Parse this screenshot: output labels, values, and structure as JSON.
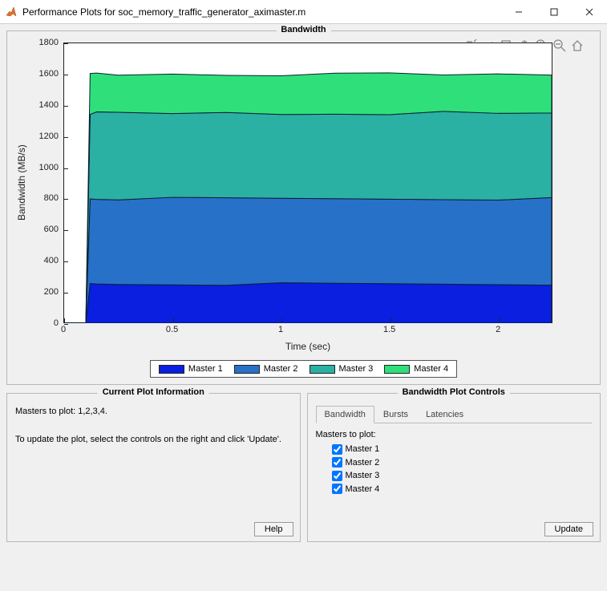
{
  "window": {
    "title": "Performance Plots for soc_memory_traffic_generator_aximaster.m"
  },
  "chart_panel": {
    "title": "Bandwidth"
  },
  "chart": {
    "ylabel": "Bandwidth (MB/s)",
    "xlabel": "Time (sec)",
    "yticks": [
      "0",
      "200",
      "400",
      "600",
      "800",
      "1000",
      "1200",
      "1400",
      "1600",
      "1800"
    ],
    "xticks": [
      "0",
      "0.5",
      "1",
      "1.5",
      "2"
    ],
    "legend": [
      "Master 1",
      "Master 2",
      "Master 3",
      "Master 4"
    ],
    "colors": [
      "#0a1fe0",
      "#2771c8",
      "#2bb0a4",
      "#2fe07a"
    ]
  },
  "chart_data": {
    "type": "area",
    "title": "Bandwidth",
    "xlabel": "Time (sec)",
    "ylabel": "Bandwidth (MB/s)",
    "xlim": [
      0,
      2.25
    ],
    "ylim": [
      0,
      1800
    ],
    "stacked": true,
    "x": [
      0,
      0.1,
      0.12,
      0.15,
      0.25,
      0.5,
      0.75,
      1.0,
      1.25,
      1.5,
      1.75,
      2.0,
      2.25
    ],
    "series": [
      {
        "name": "Master 1",
        "color": "#0a1fe0",
        "values": [
          0,
          0,
          250,
          250,
          250,
          250,
          250,
          250,
          250,
          250,
          250,
          250,
          250
        ]
      },
      {
        "name": "Master 2",
        "color": "#2771c8",
        "values": [
          0,
          0,
          550,
          550,
          550,
          550,
          550,
          550,
          550,
          550,
          550,
          550,
          550
        ]
      },
      {
        "name": "Master 3",
        "color": "#2bb0a4",
        "values": [
          0,
          0,
          550,
          550,
          550,
          545,
          555,
          545,
          550,
          550,
          555,
          545,
          550
        ]
      },
      {
        "name": "Master 4",
        "color": "#2fe07a",
        "values": [
          0,
          0,
          250,
          255,
          245,
          260,
          245,
          255,
          250,
          255,
          240,
          260,
          250
        ]
      }
    ]
  },
  "info_panel": {
    "title": "Current Plot Information",
    "line1": "Masters to plot: 1,2,3,4.",
    "line2": "To update the plot, select the controls on the right and click 'Update'.",
    "help": "Help"
  },
  "ctrl_panel": {
    "title": "Bandwidth Plot Controls",
    "tabs": [
      "Bandwidth",
      "Bursts",
      "Latencies"
    ],
    "masters_label": "Masters to plot:",
    "masters": [
      "Master 1",
      "Master 2",
      "Master 3",
      "Master 4"
    ],
    "update": "Update"
  }
}
